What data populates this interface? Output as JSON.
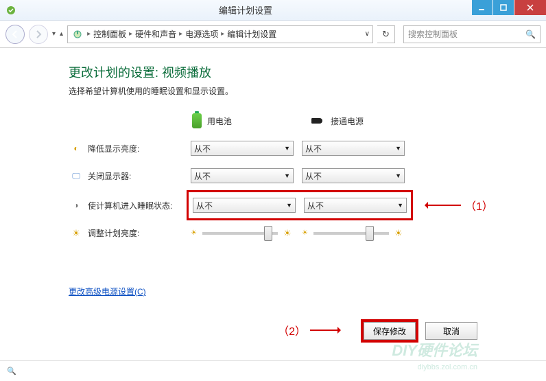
{
  "titlebar": {
    "title": "编辑计划设置"
  },
  "breadcrumb": {
    "items": [
      "控制面板",
      "硬件和声音",
      "电源选项",
      "编辑计划设置"
    ]
  },
  "search": {
    "placeholder": "搜索控制面板"
  },
  "page": {
    "heading": "更改计划的设置: 视频播放",
    "subhead": "选择希望计算机使用的睡眠设置和显示设置。"
  },
  "columns": {
    "battery": "用电池",
    "ac": "接通电源"
  },
  "rows": {
    "dim": {
      "label": "降低显示亮度:",
      "battery": "从不",
      "ac": "从不"
    },
    "off": {
      "label": "关闭显示器:",
      "battery": "从不",
      "ac": "从不"
    },
    "sleep": {
      "label": "使计算机进入睡眠状态:",
      "battery": "从不",
      "ac": "从不"
    },
    "brightness": {
      "label": "调整计划亮度:"
    }
  },
  "annotations": {
    "a1": "（1）",
    "a2": "（2）"
  },
  "link": "更改高级电源设置(C)",
  "buttons": {
    "save": "保存修改",
    "cancel": "取消"
  },
  "watermark": {
    "big": "DIY硬件论坛",
    "small": "diybbs.zol.com.cn"
  }
}
